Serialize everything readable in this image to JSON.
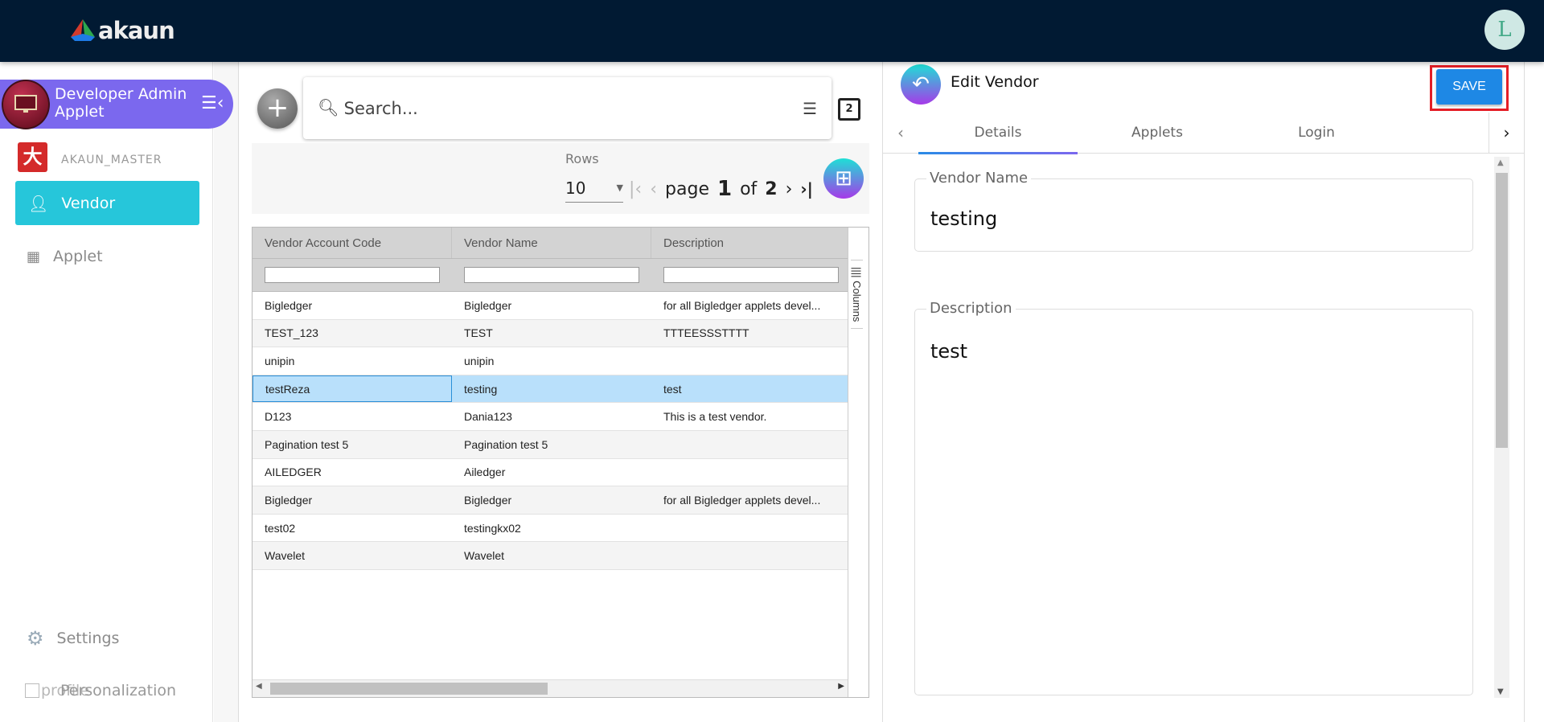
{
  "header": {
    "brand": "akaun",
    "avatar_letter": "L"
  },
  "sidebar": {
    "applet_title": "Developer Admin Applet",
    "org": "AKAUN_MASTER",
    "items": [
      {
        "label": "Vendor",
        "icon": "person-icon",
        "active": true
      },
      {
        "label": "Applet",
        "icon": "grid-icon"
      }
    ],
    "settings": "Settings",
    "personalization": "Personalization",
    "profile": "profile"
  },
  "list": {
    "search_placeholder": "Search...",
    "rows_label": "Rows",
    "rows_value": "10",
    "page_word": "page",
    "page": "1",
    "of_word": "of",
    "total_pages": "2",
    "columns_label": "Columns",
    "columns": [
      "Vendor Account Code",
      "Vendor Name",
      "Description"
    ],
    "rows": [
      [
        "Bigledger",
        "Bigledger",
        "for all Bigledger applets devel..."
      ],
      [
        "TEST_123",
        "TEST",
        "TTTEESSSTTTT"
      ],
      [
        "unipin",
        "unipin",
        ""
      ],
      [
        "testReza",
        "testing",
        "test"
      ],
      [
        "D123",
        "Dania123",
        "This is a test vendor."
      ],
      [
        "Pagination test 5",
        "Pagination test 5",
        ""
      ],
      [
        "AILEDGER",
        "Ailedger",
        ""
      ],
      [
        "Bigledger",
        "Bigledger",
        "for all Bigledger applets devel..."
      ],
      [
        "test02",
        "testingkx02",
        ""
      ],
      [
        "Wavelet",
        "Wavelet",
        ""
      ]
    ],
    "selected_row": 3
  },
  "edit": {
    "title": "Edit Vendor",
    "save": "SAVE",
    "tabs": [
      "Details",
      "Applets",
      "Login"
    ],
    "vendor_name_label": "Vendor Name",
    "vendor_name": "testing",
    "description_label": "Description",
    "description": "test"
  },
  "colors": {
    "header": "#011a33",
    "accent": "#26c6da",
    "applet": "#7b68ee",
    "save": "#1e88e5",
    "highlight": "#e41e26"
  }
}
